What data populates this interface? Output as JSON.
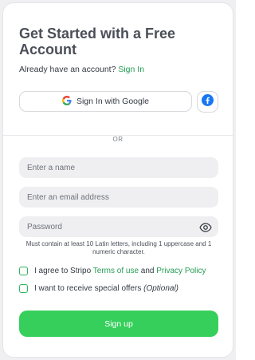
{
  "header": {
    "title": "Get Started with a Free Account",
    "already_text": "Already have an account?",
    "sign_in_link": "Sign In"
  },
  "social": {
    "google_label": "Sign In with Google",
    "google_icon": "google-icon",
    "facebook_icon": "facebook-icon"
  },
  "divider": {
    "label": "OR"
  },
  "form": {
    "name_placeholder": "Enter a name",
    "email_placeholder": "Enter an email address",
    "password_placeholder": "Password",
    "password_hint": "Must contain at least 10 Latin letters, including 1 uppercase and 1 numeric character."
  },
  "agree": {
    "prefix": "I agree to Stripo",
    "terms_link": "Terms of use",
    "and": "and",
    "privacy_link": "Privacy Policy",
    "checked": false
  },
  "offers": {
    "label": "I want to receive special offers",
    "optional": "(Optional)",
    "checked": false
  },
  "submit": {
    "label": "Sign up"
  },
  "colors": {
    "accent": "#36cf5c",
    "link": "#229c52",
    "field_bg": "#efeff1",
    "title": "#4b4f58"
  }
}
